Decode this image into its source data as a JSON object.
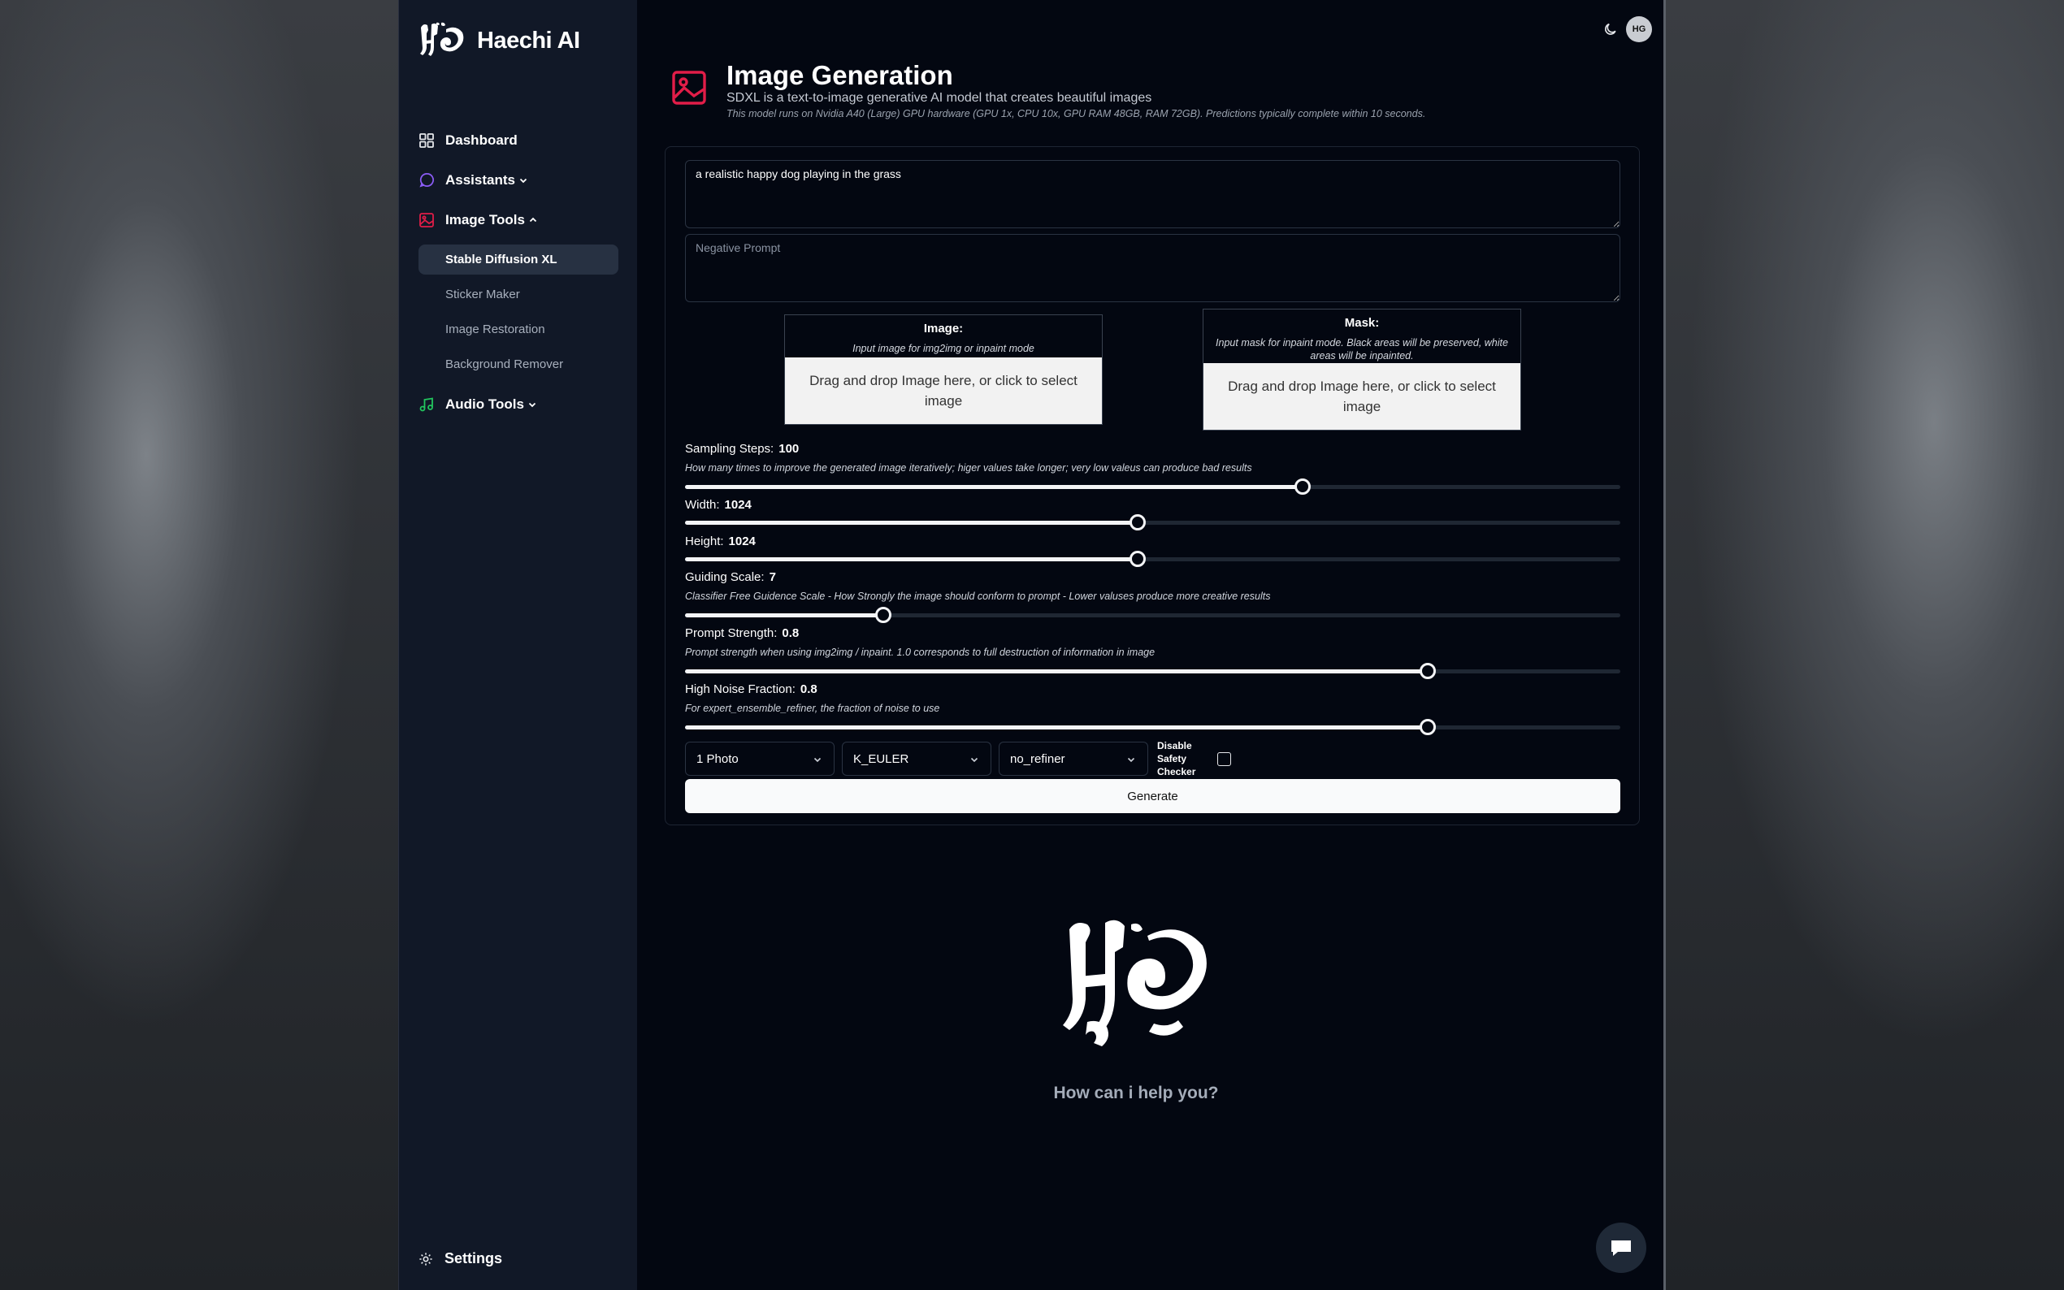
{
  "app": {
    "brand": "Haechi AI"
  },
  "sidebar": {
    "items": [
      {
        "label": "Dashboard"
      },
      {
        "label": "Assistants"
      },
      {
        "label": "Image Tools"
      },
      {
        "label": "Audio Tools"
      }
    ],
    "image_tools_sub": [
      {
        "label": "Stable Diffusion XL"
      },
      {
        "label": "Sticker Maker"
      },
      {
        "label": "Image Restoration"
      },
      {
        "label": "Background Remover"
      }
    ],
    "settings": "Settings"
  },
  "topbar": {
    "avatar_initials": "HG"
  },
  "header": {
    "title": "Image Generation",
    "description": "SDXL is a text-to-image generative AI model that creates beautiful images",
    "hardware": "This model runs on Nvidia A40 (Large) GPU hardware (GPU 1x, CPU 10x, GPU RAM 48GB, RAM 72GB). Predictions typically complete within 10 seconds."
  },
  "form": {
    "prompt_value": "a realistic happy dog playing in the grass",
    "negative_placeholder": "Negative Prompt",
    "image": {
      "title": "Image:",
      "hint": "Input image for img2img or inpaint mode",
      "drop_text": "Drag and drop Image here, or click to select image"
    },
    "mask": {
      "title": "Mask:",
      "hint": "Input mask for inpaint mode. Black areas will be preserved, white areas will be inpainted.",
      "drop_text": "Drag and drop Image here, or click to select image"
    },
    "params": {
      "steps": {
        "label": "Sampling Steps:",
        "value": 100,
        "display": "100",
        "hint": "How many times to improve the generated image iteratively; higer values take longer; very low valeus can produce bad results",
        "fraction": 0.66
      },
      "width": {
        "label": "Width:",
        "value": 1024,
        "display": "1024",
        "fraction": 0.484
      },
      "height": {
        "label": "Height:",
        "value": 1024,
        "display": "1024",
        "fraction": 0.484
      },
      "guidance": {
        "label": "Guiding Scale:",
        "value": 7,
        "display": "7",
        "hint": "Classifier Free Guidence Scale - How Strongly the image should conform to prompt - Lower valuses produce more creative results",
        "fraction": 0.212
      },
      "prompt_strength": {
        "label": "Prompt Strength:",
        "value": 0.8,
        "display": "0.8",
        "hint": "Prompt strength when using img2img / inpaint. 1.0 corresponds to full destruction of information in image",
        "fraction": 0.794
      },
      "noise": {
        "label": "High Noise Fraction:",
        "value": 0.8,
        "display": "0.8",
        "hint": "For expert_ensemble_refiner, the fraction of noise to use",
        "fraction": 0.794
      }
    },
    "num_outputs": "1 Photo",
    "scheduler": "K_EULER",
    "refiner": "no_refiner",
    "safety_label": "Disable Safety Checker",
    "safety_checked": false,
    "generate": "Generate"
  },
  "welcome": {
    "text": "How can i help you?"
  },
  "colors": {
    "accent": "#e11d48",
    "assistant_icon": "#8b5cf6",
    "audio_icon": "#22c55e",
    "background": "#030711",
    "sidebar": "#111827"
  },
  "icons": {
    "dashboard": "grid-icon",
    "assistants": "chat-bubble-icon",
    "image_tools": "image-icon",
    "audio_tools": "music-note-icon",
    "settings": "gear-icon",
    "theme": "moon-icon",
    "chat": "chat-icon"
  }
}
